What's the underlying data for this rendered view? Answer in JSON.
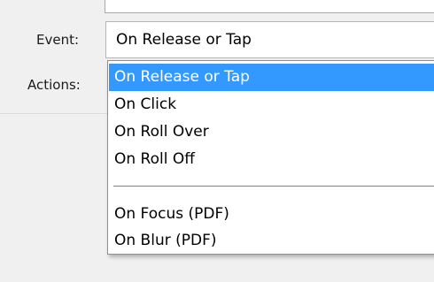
{
  "labels": {
    "event": "Event:",
    "actions": "Actions:"
  },
  "event_select": {
    "value": "On Release or Tap"
  },
  "dropdown": {
    "group1": [
      "On Release or Tap",
      "On Click",
      "On Roll Over",
      "On Roll Off"
    ],
    "group2": [
      "On Focus (PDF)",
      "On Blur (PDF)"
    ],
    "selected_index": 0
  },
  "colors": {
    "highlight": "#3399ff",
    "background": "#f0f0f0"
  }
}
